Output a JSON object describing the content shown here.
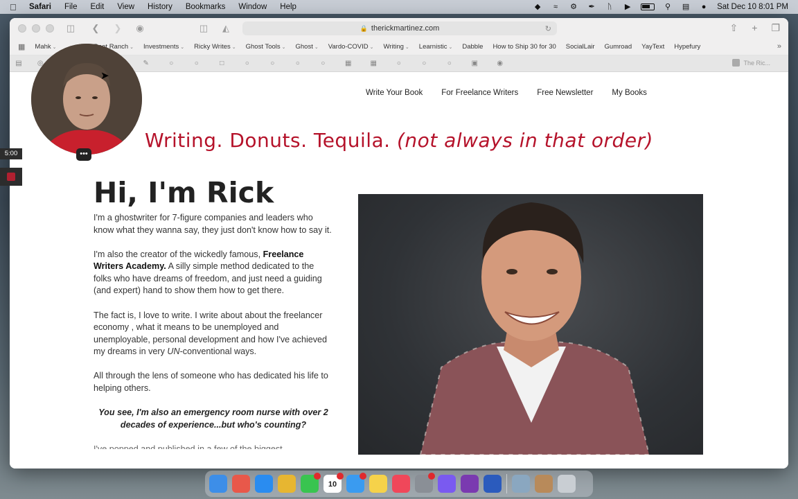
{
  "menubar": {
    "app": "Safari",
    "menus": [
      "File",
      "Edit",
      "View",
      "History",
      "Bookmarks",
      "Window",
      "Help"
    ],
    "clock": "Sat Dec 10  8:01 PM"
  },
  "toolbar": {
    "url": "therickmartinez.com"
  },
  "favorites": [
    {
      "label": "Mahk",
      "has_menu": true
    },
    {
      "label": "Boot Ranch",
      "has_menu": true
    },
    {
      "label": "Investments",
      "has_menu": true
    },
    {
      "label": "Ricky Writes",
      "has_menu": true
    },
    {
      "label": "Ghost Tools",
      "has_menu": true
    },
    {
      "label": "Ghost",
      "has_menu": true
    },
    {
      "label": "Vardo-COVID",
      "has_menu": true
    },
    {
      "label": "Writing",
      "has_menu": true
    },
    {
      "label": "Learnistic",
      "has_menu": true
    },
    {
      "label": "Dabble",
      "has_menu": false
    },
    {
      "label": "How to Ship 30 for 30",
      "has_menu": false
    },
    {
      "label": "SocialLair",
      "has_menu": false
    },
    {
      "label": "Gumroad",
      "has_menu": false
    },
    {
      "label": "YayText",
      "has_menu": false
    },
    {
      "label": "Hypefury",
      "has_menu": false
    }
  ],
  "last_tab_label": "The Ric...",
  "recorder": {
    "timer": "5:00"
  },
  "site": {
    "nav": [
      "Write Your Book",
      "For Freelance Writers",
      "Free Newsletter",
      "My Books"
    ],
    "tagline_main": "Writing. Donuts. Tequila.",
    "tagline_italic": "(not always in that order)",
    "greeting": "Hi, I'm Rick",
    "p1": "I'm a ghostwriter for 7-figure companies and leaders who know what they wanna say, they just don't know how to say it.",
    "p2_a": "I'm also the creator of the wickedly famous, ",
    "p2_bold": "Freelance Writers Academy.",
    "p2_b": " A silly simple method dedicated to the folks who have dreams of freedom, and just need a guiding (and expert) hand to show them how to get there.",
    "p3_a": "The fact is, I love to write. I write about about the freelancer economy , what it means to be unemployed and unemployable, personal development and how I've achieved my dreams in very ",
    "p3_em": "UN",
    "p3_b": "-conventional ways.",
    "p4": "All through the lens of someone who has dedicated his life to helping others.",
    "p5": "You see, I'm also an emergency room nurse with over 2 decades of experience...but who's counting?",
    "p6_partial": "I've popped and published in a few of the biggest"
  },
  "dock": {
    "calendar_day": "10",
    "apps": [
      {
        "name": "finder-icon",
        "color": "#3d8ee8",
        "badge": false
      },
      {
        "name": "launchpad-icon",
        "color": "#e8584a",
        "badge": false
      },
      {
        "name": "safari-icon",
        "color": "#2a8cf0",
        "badge": false
      },
      {
        "name": "chrome-icon",
        "color": "#e7b631",
        "badge": false
      },
      {
        "name": "messages-icon",
        "color": "#39c450",
        "badge": true
      },
      {
        "name": "calendar-icon",
        "color": "#ffffff",
        "badge": true
      },
      {
        "name": "mail-icon",
        "color": "#3a9bf0",
        "badge": true
      },
      {
        "name": "notes-icon",
        "color": "#f6d24a",
        "badge": false
      },
      {
        "name": "music-icon",
        "color": "#f0475a",
        "badge": false
      },
      {
        "name": "system-preferences-icon",
        "color": "#8a8f96",
        "badge": true
      },
      {
        "name": "browser-icon",
        "color": "#7a5af0",
        "badge": false
      },
      {
        "name": "onenote-icon",
        "color": "#7a3ab0",
        "badge": false
      },
      {
        "name": "word-icon",
        "color": "#2b5bbd",
        "badge": false
      },
      {
        "name": "preview-icon",
        "color": "#8aa7c0",
        "badge": false
      },
      {
        "name": "app-icon",
        "color": "#b88a5a",
        "badge": false
      },
      {
        "name": "trash-icon",
        "color": "#c9ced3",
        "badge": false
      }
    ]
  }
}
